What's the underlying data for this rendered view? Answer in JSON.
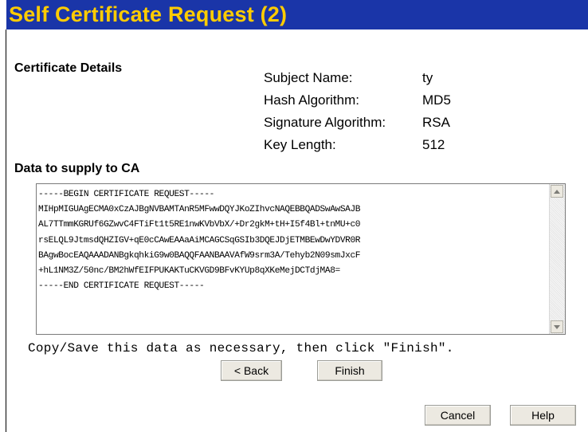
{
  "header": {
    "title": "Self Certificate Request (2)"
  },
  "details": {
    "section_label": "Certificate Details",
    "fields": [
      {
        "label": "Subject Name:",
        "value": "ty"
      },
      {
        "label": "Hash Algorithm:",
        "value": "MD5"
      },
      {
        "label": "Signature Algorithm:",
        "value": "RSA"
      },
      {
        "label": "Key Length:",
        "value": "512"
      }
    ]
  },
  "ca_data": {
    "section_label": "Data to supply to CA",
    "certificate_text": "-----BEGIN CERTIFICATE REQUEST-----\nMIHpMIGUAgECMA0xCzAJBgNVBAMTAnR5MFwwDQYJKoZIhvcNAQEBBQADSwAwSAJB\nAL7TTmmKGRUf6GZwvC4FTiFt1t5RE1nwKVbVbX/+Dr2gkM+tH+I5f4Bl+tnMU+c0\nrsELQL9JtmsdQHZIGV+qE0cCAwEAAaAiMCAGCSqGSIb3DQEJDjETMBEwDwYDVR0R\nBAgwBocEAQAAADANBgkqhkiG9w0BAQQFAANBAAVAfW9srm3A/Tehyb2N09smJxcF\n+hL1NM3Z/50nc/BM2hWfEIFPUKAKTuCKVGD9BFvKYUp8qXKeMejDCTdjMA8=\n-----END CERTIFICATE REQUEST-----",
    "instruction": "Copy/Save this data as necessary, then click \"Finish\"."
  },
  "buttons": {
    "back": "< Back",
    "finish": "Finish",
    "cancel": "Cancel",
    "help": "Help"
  },
  "icons": {
    "scroll_up": "arrow-up-icon",
    "scroll_down": "arrow-down-icon"
  },
  "colors": {
    "title_bar": "#1a35a8",
    "title_text": "#ffcc00"
  }
}
